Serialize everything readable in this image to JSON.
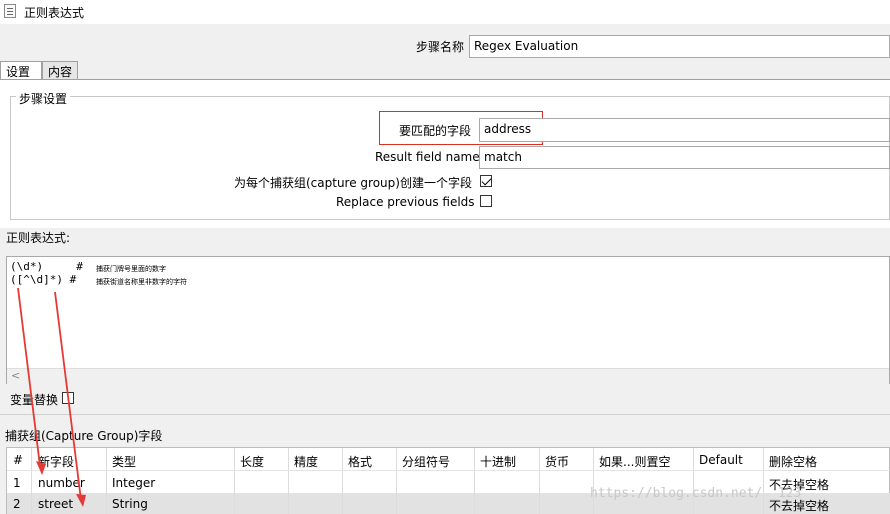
{
  "window": {
    "title": "正则表达式"
  },
  "step": {
    "label": "步骤名称",
    "value": "Regex Evaluation"
  },
  "tabs": [
    {
      "label": "设置"
    },
    {
      "label": "内容"
    }
  ],
  "settings": {
    "group_title": "步骤设置",
    "match_field": {
      "label": "要匹配的字段",
      "value": "address"
    },
    "result_field": {
      "label": "Result field name",
      "value": "match"
    },
    "create_field_per_group": {
      "label": "为每个捕获组(capture group)创建一个字段",
      "checked": true
    },
    "replace_previous": {
      "label": "Replace previous fields",
      "checked": false
    }
  },
  "regex": {
    "label": "正则表达式:",
    "lines": [
      {
        "code": "(\\d*)     #",
        "comment": "捕获门牌号里面的数字"
      },
      {
        "code": "([^\\d]*) #",
        "comment": "捕获街道名称里非数字的字符"
      }
    ],
    "scroll_left": "<"
  },
  "variable_replace": {
    "label": "变量替换"
  },
  "capture_section": {
    "label": "捕获组(Capture Group)字段"
  },
  "table": {
    "headers": [
      "#",
      "新字段",
      "类型",
      "长度",
      "精度",
      "格式",
      "分组符号",
      "十进制",
      "货币",
      "如果...则置空",
      "Default",
      "删除空格"
    ],
    "rows": [
      [
        "1",
        "number",
        "Integer",
        "",
        "",
        "",
        "",
        "",
        "",
        "",
        "",
        "不去掉空格"
      ],
      [
        "2",
        "street",
        "String",
        "",
        "",
        "",
        "",
        "",
        "",
        "",
        "",
        "不去掉空格"
      ]
    ]
  },
  "watermark": "https://blog.csdn.net/    _123",
  "colors": {
    "highlight_border": "#d93025",
    "arrow": "#e53935"
  }
}
